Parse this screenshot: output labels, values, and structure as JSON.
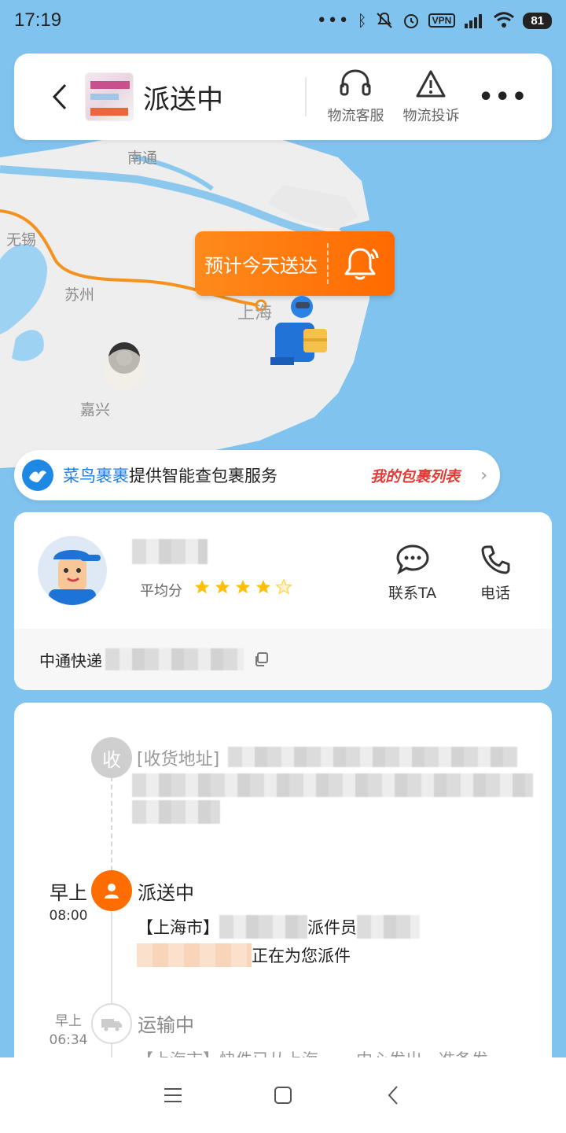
{
  "status_bar": {
    "time": "17:19",
    "vpn": "VPN",
    "battery": "81"
  },
  "header": {
    "title": "派送中",
    "actions": [
      {
        "label": "物流客服",
        "icon": "headset-icon"
      },
      {
        "label": "物流投诉",
        "icon": "warning-icon"
      }
    ],
    "more_icon": "more-icon"
  },
  "map": {
    "cities": [
      "南通",
      "无锡",
      "苏州",
      "上海",
      "嘉兴"
    ],
    "eta_text": "预计今天送达"
  },
  "banner": {
    "brand": "菜鸟裹裹",
    "text": "提供智能查包裹服务",
    "promo": "我的包裹列表"
  },
  "courier": {
    "score_label": "平均分",
    "rating": 4,
    "rating_max": 5,
    "contact_label": "联系TA",
    "phone_label": "电话",
    "company": "中通快递"
  },
  "timeline": {
    "address_label": "[收货地址]",
    "address_node": "收",
    "events": [
      {
        "day": "早上",
        "time": "08:00",
        "title": "派送中",
        "line1_prefix": "【上海市】",
        "line1_mid": "派件员",
        "line2_suffix": "正在为您派件"
      },
      {
        "day": "早上",
        "time": "06:34",
        "title": "运输中",
        "line1": "【上海市】快件已从上海",
        "line1_tail": "中心发出，准备发"
      }
    ]
  },
  "colors": {
    "accent": "#ff6d00",
    "brand_blue": "#1e88e5",
    "map_water": "#80c3ee",
    "map_land": "#eeeeee",
    "route": "#f5921e"
  }
}
